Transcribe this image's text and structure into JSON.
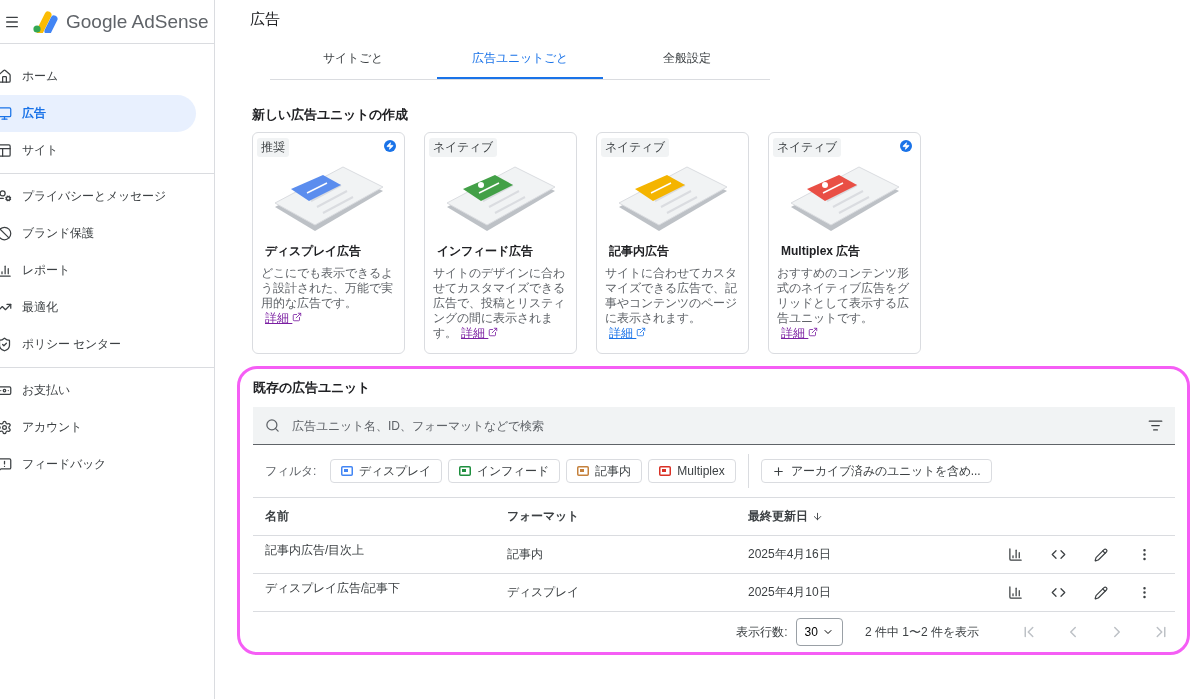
{
  "header": {
    "product": "Google AdSense",
    "page_title": "広告"
  },
  "sidebar": {
    "groups": [
      [
        {
          "label": "ホーム",
          "selected": false
        },
        {
          "label": "広告",
          "selected": true
        },
        {
          "label": "サイト",
          "selected": false
        }
      ],
      [
        {
          "label": "プライバシーとメッセージ",
          "selected": false
        },
        {
          "label": "ブランド保護",
          "selected": false
        },
        {
          "label": "レポート",
          "selected": false
        },
        {
          "label": "最適化",
          "selected": false
        },
        {
          "label": "ポリシー センター",
          "selected": false
        }
      ],
      [
        {
          "label": "お支払い",
          "selected": false
        },
        {
          "label": "アカウント",
          "selected": false
        },
        {
          "label": "フィードバック",
          "selected": false
        }
      ]
    ]
  },
  "tabs": [
    {
      "label": "サイトごと",
      "selected": false
    },
    {
      "label": "広告ユニットごと",
      "selected": true
    },
    {
      "label": "全般設定",
      "selected": false
    }
  ],
  "create_section": {
    "title": "新しい広告ユニットの作成",
    "cards": [
      {
        "kind": "display",
        "badge": "推奨",
        "bolt": true,
        "title": "ディスプレイ広告",
        "description": "どこにでも表示できるよう設計された、万能で実用的な広告です。",
        "link": "詳細",
        "visited": true
      },
      {
        "kind": "infeed",
        "badge": "ネイティブ",
        "bolt": false,
        "title": "インフィード広告",
        "description": "サイトのデザインに合わせてカスタマイズできる広告で、投稿とリスティングの間に表示されます。",
        "link": "詳細",
        "visited": true
      },
      {
        "kind": "inarticle",
        "badge": "ネイティブ",
        "bolt": false,
        "title": "記事内広告",
        "description": "サイトに合わせてカスタマイズできる広告で、記事やコンテンツのページに表示されます。",
        "link": "詳細",
        "visited": false
      },
      {
        "kind": "multiplex",
        "badge": "ネイティブ",
        "bolt": true,
        "title": "Multiplex 広告",
        "description": "おすすめのコンテンツ形式のネイティブ広告をグリッドとして表示する広告ユニットです。",
        "link": "詳細",
        "visited": true
      }
    ]
  },
  "existing_section": {
    "title": "既存の広告ユニット",
    "search": {
      "placeholder": "広告ユニット名、ID、フォーマットなどで検索"
    },
    "filter_label": "フィルタ:",
    "filters": [
      {
        "label": "ディスプレイ",
        "color": "#4285f4"
      },
      {
        "label": "インフィード",
        "color": "#1e8e3e"
      },
      {
        "label": "記事内",
        "color": "#c5813c"
      },
      {
        "label": "Multiplex",
        "color": "#d93025"
      }
    ],
    "archive_button": "アーカイブ済みのユニットを含め...",
    "table": {
      "columns": [
        "名前",
        "フォーマット",
        "最終更新日"
      ],
      "rows": [
        {
          "name": "記事内広告/目次上",
          "format": "記事内",
          "updated": "2025年4月16日"
        },
        {
          "name": "ディスプレイ広告/記事下",
          "format": "ディスプレイ",
          "updated": "2025年4月10日"
        }
      ]
    },
    "pagination": {
      "rows_label": "表示行数:",
      "rows_value": "30",
      "range": "2 件中 1〜2 件を表示"
    }
  }
}
